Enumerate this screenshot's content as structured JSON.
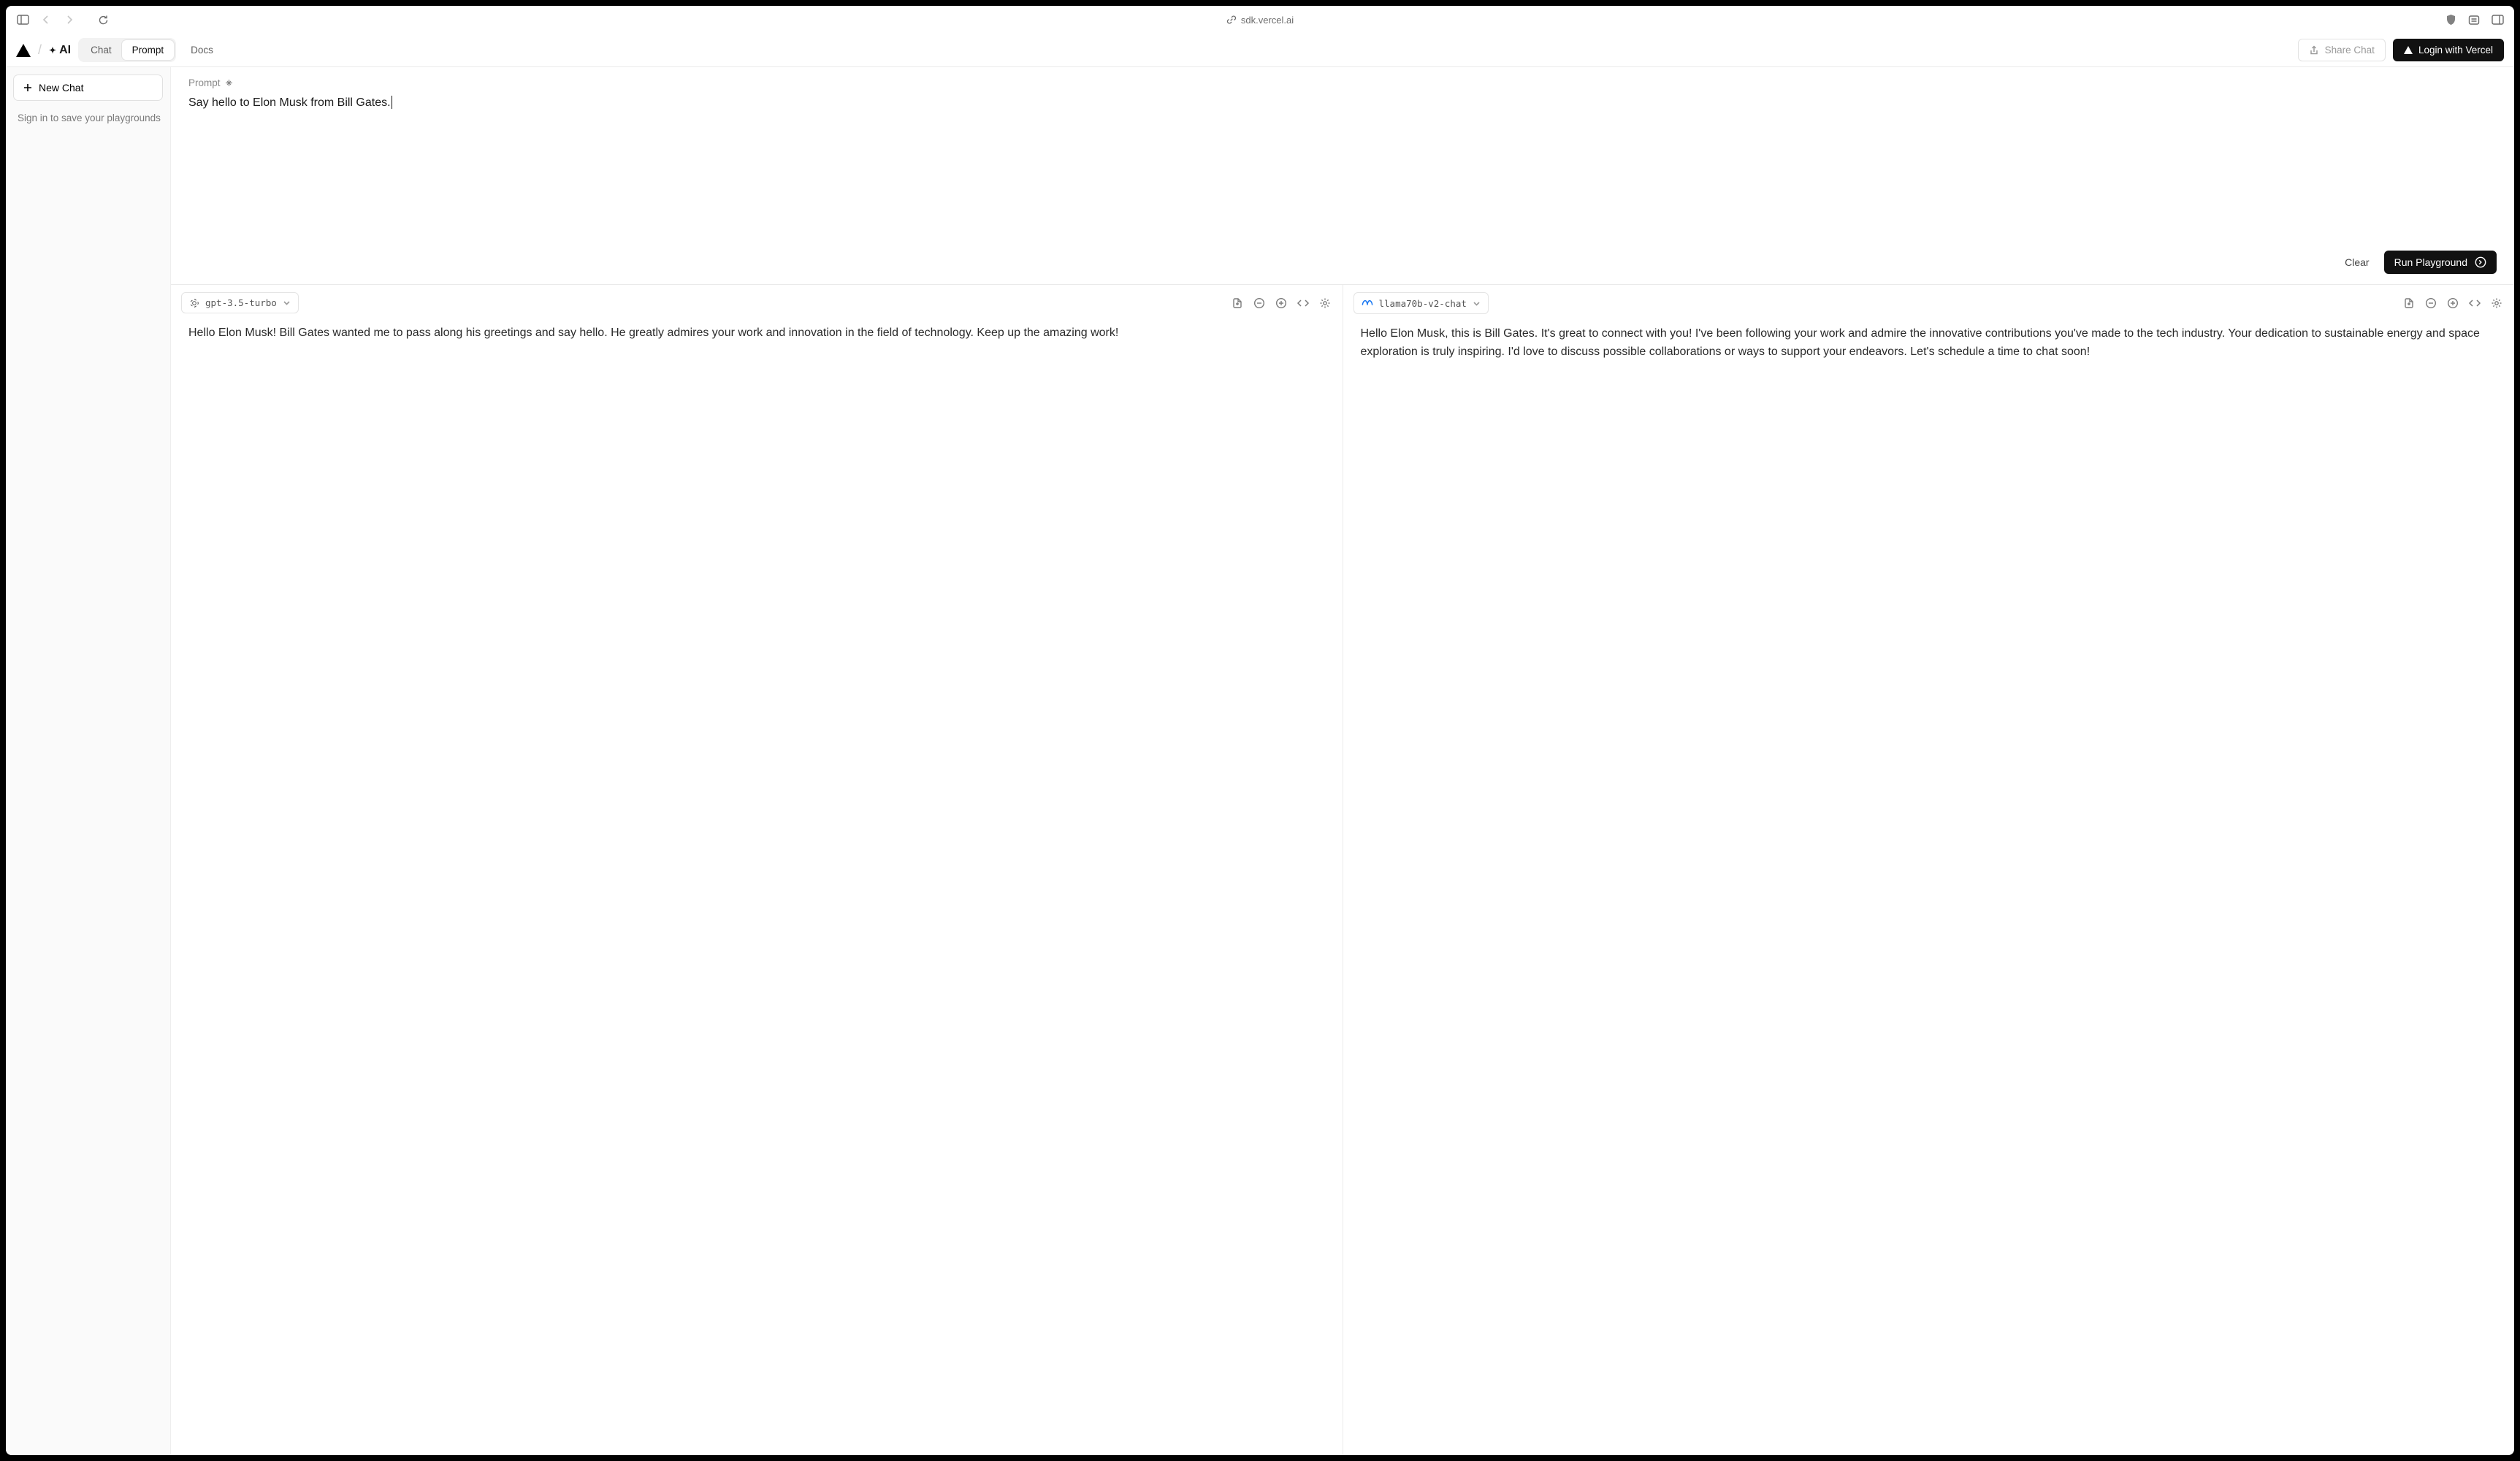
{
  "browser": {
    "url": "sdk.vercel.ai"
  },
  "header": {
    "brand_ai": "AI",
    "tabs": {
      "chat": "Chat",
      "prompt": "Prompt"
    },
    "docs": "Docs",
    "share": "Share Chat",
    "login": "Login with Vercel"
  },
  "sidebar": {
    "new_chat": "New Chat",
    "signin_hint": "Sign in to save your playgrounds"
  },
  "prompt": {
    "label": "Prompt",
    "text": "Say hello to Elon Musk from Bill Gates.",
    "clear": "Clear",
    "run": "Run Playground"
  },
  "outputs": [
    {
      "model": "gpt-3.5-turbo",
      "provider": "openai",
      "response": "Hello Elon Musk! Bill Gates wanted me to pass along his greetings and say hello. He greatly admires your work and innovation in the field of technology. Keep up the amazing work!"
    },
    {
      "model": "llama70b-v2-chat",
      "provider": "meta",
      "response": "Hello Elon Musk, this is Bill Gates. It's great to connect with you! I've been following your work and admire the innovative contributions you've made to the tech industry. Your dedication to sustainable energy and space exploration is truly inspiring. I'd love to discuss possible collaborations or ways to support your endeavors. Let's schedule a time to chat soon!"
    }
  ]
}
